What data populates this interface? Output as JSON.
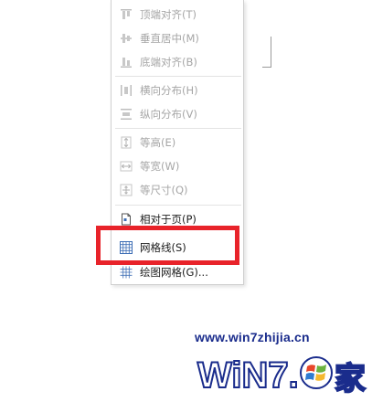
{
  "menu": {
    "items": [
      {
        "label": "顶端对齐(T)",
        "icon": "align-top-icon",
        "enabled": false
      },
      {
        "label": "垂直居中(M)",
        "icon": "align-middle-icon",
        "enabled": false
      },
      {
        "label": "底端对齐(B)",
        "icon": "align-bottom-icon",
        "enabled": false
      },
      {
        "label": "横向分布(H)",
        "icon": "distribute-horizontal-icon",
        "enabled": false
      },
      {
        "label": "纵向分布(V)",
        "icon": "distribute-vertical-icon",
        "enabled": false
      },
      {
        "label": "等高(E)",
        "icon": "equal-height-icon",
        "enabled": false
      },
      {
        "label": "等宽(W)",
        "icon": "equal-width-icon",
        "enabled": false
      },
      {
        "label": "等尺寸(Q)",
        "icon": "equal-size-icon",
        "enabled": false
      },
      {
        "label": "相对于页(P)",
        "icon": "relative-to-page-icon",
        "enabled": true
      },
      {
        "label": "网格线(S)",
        "icon": "gridlines-icon",
        "enabled": true
      },
      {
        "label": "绘图网格(G)...",
        "icon": "drawing-grid-icon",
        "enabled": true
      }
    ]
  },
  "watermark": {
    "url": "www.win7zhijia.cn",
    "logo_text": "WiN7.",
    "logo_suffix": "家"
  },
  "colors": {
    "highlight": "#e8232a",
    "watermark_blue": "#1a2c8c",
    "icon_blue": "#3f6fb5"
  }
}
